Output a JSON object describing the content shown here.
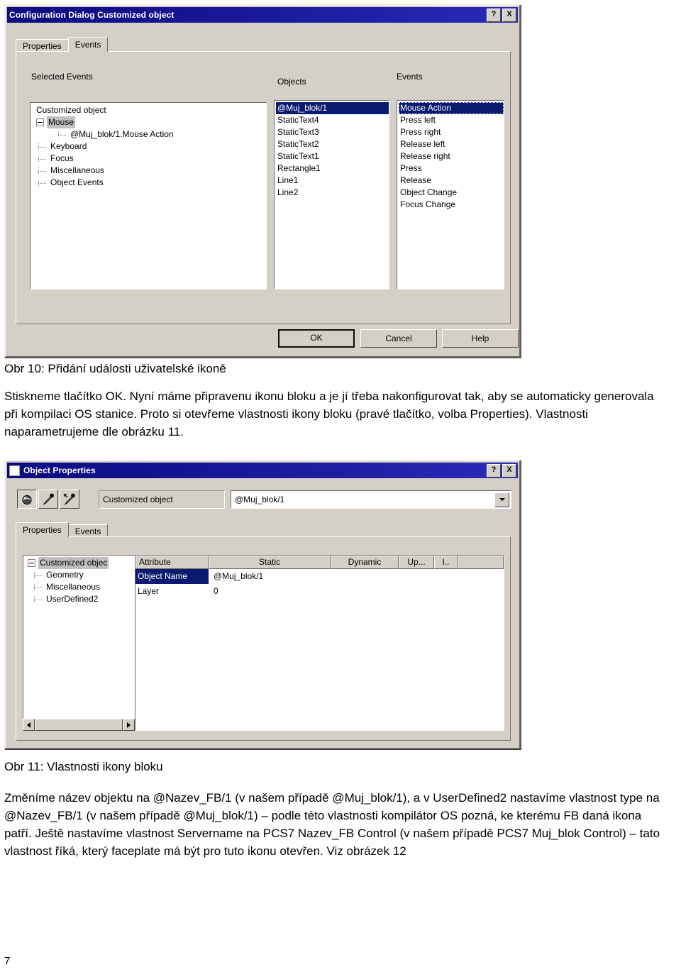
{
  "page": {
    "number": "7",
    "language": "cs"
  },
  "figure10": {
    "dialog": {
      "title": "Configuration Dialog Customized object",
      "help_button": "?",
      "close_button": "X",
      "tabs": [
        {
          "label": "Properties",
          "active": false
        },
        {
          "label": "Events",
          "active": true
        }
      ],
      "group_labels": {
        "selected_events": "Selected Events",
        "objects": "Objects",
        "events": "Events"
      },
      "tree": [
        {
          "label": "Customized object",
          "level": 0,
          "kind": "root",
          "selected": false
        },
        {
          "label": "Mouse",
          "level": 1,
          "kind": "expander",
          "selected": true
        },
        {
          "label": "@Muj_blok/1.Mouse Action",
          "level": 2,
          "kind": "leaf",
          "selected": false
        },
        {
          "label": "Keyboard",
          "level": 1,
          "kind": "leaf",
          "selected": false
        },
        {
          "label": "Focus",
          "level": 1,
          "kind": "leaf",
          "selected": false
        },
        {
          "label": "Miscellaneous",
          "level": 1,
          "kind": "leaf",
          "selected": false
        },
        {
          "label": "Object Events",
          "level": 1,
          "kind": "leaf",
          "selected": false
        }
      ],
      "objects_list": [
        {
          "label": "@Muj_blok/1",
          "selected": true
        },
        {
          "label": "StaticText4",
          "selected": false
        },
        {
          "label": "StaticText3",
          "selected": false
        },
        {
          "label": "StaticText2",
          "selected": false
        },
        {
          "label": "StaticText1",
          "selected": false
        },
        {
          "label": "Rectangle1",
          "selected": false
        },
        {
          "label": "Line1",
          "selected": false
        },
        {
          "label": "Line2",
          "selected": false
        }
      ],
      "events_list": [
        {
          "label": "Mouse Action",
          "selected": true
        },
        {
          "label": "Press left",
          "selected": false
        },
        {
          "label": "Press right",
          "selected": false
        },
        {
          "label": "Release left",
          "selected": false
        },
        {
          "label": "Release right",
          "selected": false
        },
        {
          "label": "Press",
          "selected": false
        },
        {
          "label": "Release",
          "selected": false
        },
        {
          "label": "Object Change",
          "selected": false
        },
        {
          "label": "Focus Change",
          "selected": false
        }
      ],
      "buttons": {
        "ok": "OK",
        "cancel": "Cancel",
        "help": "Help"
      }
    },
    "caption": "Obr 10: Přidání události uživatelské ikoně"
  },
  "body_text_1": "Stiskneme tlačítko OK. Nyní máme připravenu ikonu bloku a je jí třeba nakonfigurovat tak, aby se automaticky generovala při kompilaci OS stanice. Proto si otevřeme vlastnosti ikony bloku (pravé tlačítko, volba Properties). Vlastnosti naparametrujeme dle obrázku 11.",
  "figure11": {
    "dialog": {
      "title": "Object Properties",
      "help_button": "?",
      "close_button": "X",
      "toolbar": [
        {
          "icon": "sphere-icon",
          "pressed": true
        },
        {
          "icon": "eyedropper-right-icon",
          "pressed": false
        },
        {
          "icon": "eyedropper-left-icon",
          "pressed": false
        }
      ],
      "object_type": "Customized object",
      "object_name_combo": "@Muj_blok/1",
      "tabs": [
        {
          "label": "Properties",
          "active": true
        },
        {
          "label": "Events",
          "active": false
        }
      ],
      "tree": [
        {
          "label": "Customized objec",
          "level": 0,
          "kind": "expander",
          "selected": true
        },
        {
          "label": "Geometry",
          "level": 1,
          "kind": "leaf",
          "selected": false
        },
        {
          "label": "Miscellaneous",
          "level": 1,
          "kind": "leaf",
          "selected": false
        },
        {
          "label": "UserDefined2",
          "level": 1,
          "kind": "leaf",
          "selected": false
        }
      ],
      "grid": {
        "columns": [
          "Attribute",
          "Static",
          "Dynamic",
          "Up...",
          "I.."
        ],
        "rows": [
          {
            "attribute": "Object Name",
            "static": "@Muj_blok/1",
            "selected": true
          },
          {
            "attribute": "Layer",
            "static": "0",
            "selected": false
          }
        ]
      },
      "scrollbar": {
        "left_arrow": "◀",
        "right_arrow": "▶"
      }
    },
    "caption": "Obr 11: Vlastnosti ikony bloku"
  },
  "body_text_2": "Změníme název objektu na @Nazev_FB/1 (v našem případě @Muj_blok/1), a v UserDefined2 nastavíme vlastnost type na @Nazev_FB/1 (v našem případě @Muj_blok/1) – podle této vlastnosti kompilátor OS pozná, ke kterému FB daná ikona patří. Ještě nastavíme vlastnost Servername na PCS7 Nazev_FB Control (v našem případě PCS7 Muj_blok Control) – tato vlastnost říká, který faceplate má být pro tuto ikonu otevřen. Viz obrázek 12",
  "colors": {
    "titlebar_start": "#0a0a80",
    "titlebar_end": "#2a2ab8",
    "dialog_face": "#d4d0c8",
    "selection": "#0a1a6e",
    "tree_selection": "#c0c0c0"
  }
}
